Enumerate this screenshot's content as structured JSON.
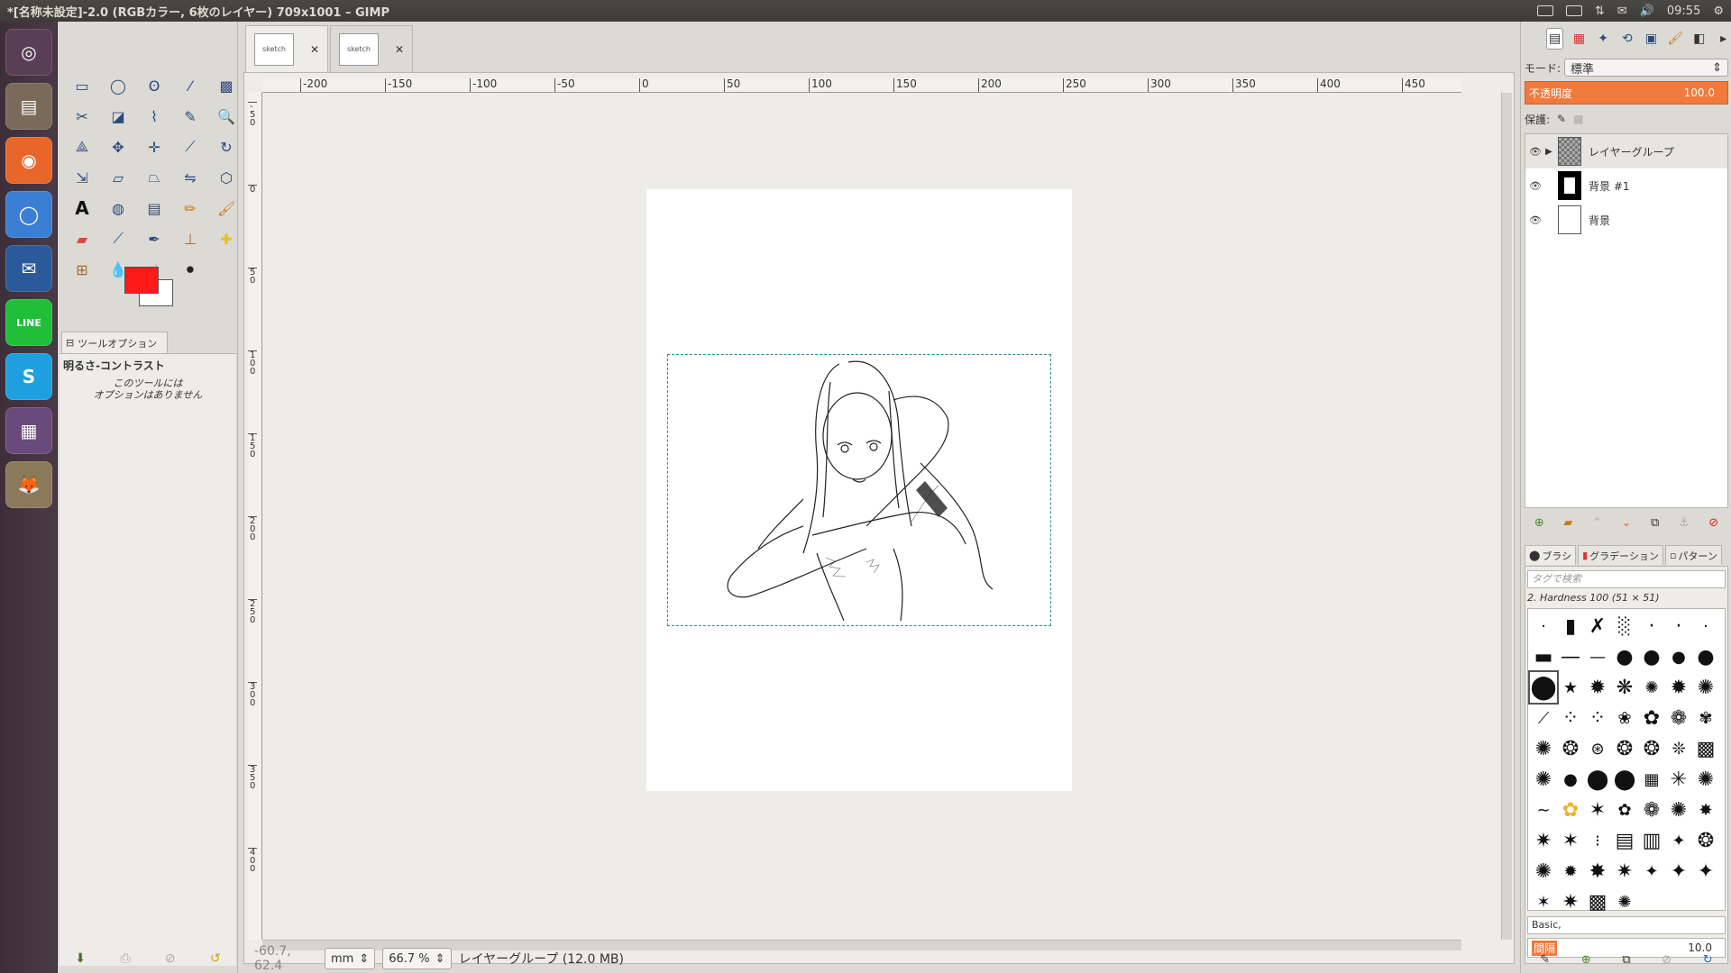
{
  "window": {
    "title": "*[名称未設定]-2.0 (RGBカラー, 6枚のレイヤー) 709x1001 – GIMP",
    "clock": "09:55"
  },
  "launcher": {
    "items": [
      {
        "name": "dash",
        "color": "#5a3e55",
        "glyph": "◎"
      },
      {
        "name": "files",
        "color": "#7a6a5a",
        "glyph": "▤"
      },
      {
        "name": "firefox",
        "color": "#e8662a",
        "glyph": "◉"
      },
      {
        "name": "chromium",
        "color": "#3b7fd4",
        "glyph": "◯"
      },
      {
        "name": "thunderbird",
        "color": "#2a5a9a",
        "glyph": "✉"
      },
      {
        "name": "line",
        "color": "#1fbf3a",
        "glyph": "LINE"
      },
      {
        "name": "skype",
        "color": "#1ea0e0",
        "glyph": "S"
      },
      {
        "name": "workspaces",
        "color": "#6a4a7a",
        "glyph": "▦"
      },
      {
        "name": "gimp",
        "color": "#8a7a5a",
        "glyph": "🦊"
      }
    ]
  },
  "toolbox": {
    "fg_color": "#ff1a1a",
    "bg_color": "#ffffff",
    "options_tab_label": "ツールオプション",
    "tool_name": "明るさ-コントラスト",
    "no_options_text": "このツールには\nオプションはありません"
  },
  "image_tabs": [
    {
      "thumb_label": "sketch"
    },
    {
      "thumb_label": "sketch"
    }
  ],
  "rulers": {
    "h_labels": [
      "-200",
      "-150",
      "-100",
      "-50",
      "0",
      "50",
      "100",
      "150",
      "200",
      "250",
      "300",
      "350",
      "400",
      "450"
    ],
    "v_labels": [
      "-50",
      "0",
      "50",
      "100",
      "150",
      "200",
      "250",
      "300",
      "350",
      "400"
    ]
  },
  "status": {
    "coords": "-60.7, 62.4",
    "unit": "mm",
    "zoom": "66.7 %",
    "layer_info": "レイヤーグループ (12.0 MB)"
  },
  "layers": {
    "mode_label": "モード:",
    "mode_value": "標準",
    "opacity_label": "不透明度",
    "opacity_value": "100.0",
    "lock_label": "保護:",
    "items": [
      {
        "name": "レイヤーグループ",
        "group": true
      },
      {
        "name": "背景 #1",
        "group": false
      },
      {
        "name": "背景",
        "group": false
      }
    ]
  },
  "brushes": {
    "tabs": [
      "ブラシ",
      "グラデーション",
      "パターン"
    ],
    "tag_placeholder": "タグで検索",
    "current_brush": "2. Hardness 100 (51 × 51)",
    "preset": "Basic,",
    "spacing_label": "間隔",
    "spacing_value": "10.0"
  }
}
